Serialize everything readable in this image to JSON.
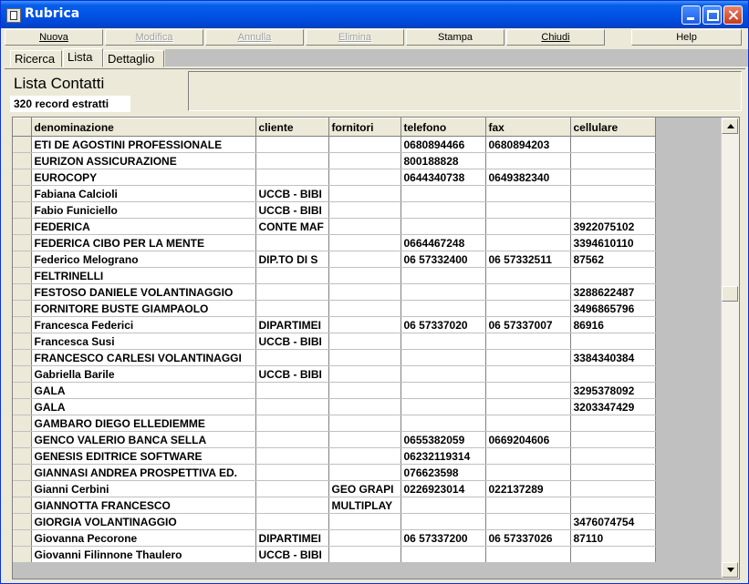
{
  "window": {
    "title": "Rubrica"
  },
  "toolbar": [
    {
      "label": "Nuova",
      "enabled": true
    },
    {
      "label": "Modifica",
      "enabled": false
    },
    {
      "label": "Annulla",
      "enabled": false
    },
    {
      "label": "Elimina",
      "enabled": false
    },
    {
      "label": "Stampa",
      "enabled": true
    },
    {
      "label": "Chiudi",
      "enabled": true
    },
    {
      "label": "Help",
      "enabled": true
    }
  ],
  "tabs": [
    {
      "label": "Ricerca",
      "active": false
    },
    {
      "label": "Lista",
      "active": true
    },
    {
      "label": "Dettaglio",
      "active": false
    }
  ],
  "list": {
    "title": "Lista Contatti",
    "record_count": "320 record estratti"
  },
  "table": {
    "columns": [
      "denominazione",
      "cliente",
      "fornitori",
      "telefono",
      "fax",
      "cellulare"
    ],
    "rows": [
      [
        "ETI DE AGOSTINI PROFESSIONALE",
        "",
        "",
        "0680894466",
        "0680894203",
        ""
      ],
      [
        "EURIZON ASSICURAZIONE",
        "",
        "",
        "800188828",
        "",
        ""
      ],
      [
        "EUROCOPY",
        "",
        "",
        "0644340738",
        "0649382340",
        ""
      ],
      [
        "Fabiana Calcioli",
        "UCCB - BIBI",
        "",
        "",
        "",
        ""
      ],
      [
        "Fabio Funiciello",
        "UCCB - BIBI",
        "",
        "",
        "",
        ""
      ],
      [
        "FEDERICA",
        "CONTE MAF",
        "",
        "",
        "",
        "3922075102"
      ],
      [
        "FEDERICA CIBO PER LA MENTE",
        "",
        "",
        "0664467248",
        "",
        "3394610110"
      ],
      [
        "Federico Melograno",
        "DIP.TO DI S",
        "",
        "06 57332400",
        "06 57332511",
        "87562"
      ],
      [
        "FELTRINELLI",
        "",
        "",
        "",
        "",
        ""
      ],
      [
        "FESTOSO DANIELE VOLANTINAGGIO",
        "",
        "",
        "",
        "",
        "3288622487"
      ],
      [
        "FORNITORE BUSTE GIAMPAOLO",
        "",
        "",
        "",
        "",
        "3496865796"
      ],
      [
        "Francesca Federici",
        "DIPARTIMEI",
        "",
        "06 57337020",
        "06 57337007",
        "86916"
      ],
      [
        "Francesca Susi",
        "UCCB - BIBI",
        "",
        "",
        "",
        ""
      ],
      [
        "FRANCESCO CARLESI VOLANTINAGGI",
        "",
        "",
        "",
        "",
        "3384340384"
      ],
      [
        "Gabriella Barile",
        "UCCB - BIBI",
        "",
        "",
        "",
        ""
      ],
      [
        "GALA",
        "",
        "",
        "",
        "",
        "3295378092"
      ],
      [
        "GALA",
        "",
        "",
        "",
        "",
        "3203347429"
      ],
      [
        "GAMBARO DIEGO ELLEDIEMME",
        "",
        "",
        "",
        "",
        ""
      ],
      [
        "GENCO VALERIO BANCA SELLA",
        "",
        "",
        "0655382059",
        "0669204606",
        ""
      ],
      [
        "GENESIS EDITRICE SOFTWARE",
        "",
        "",
        "06232119314",
        "",
        ""
      ],
      [
        "GIANNASI ANDREA PROSPETTIVA ED.",
        "",
        "",
        "076623598",
        "",
        ""
      ],
      [
        "Gianni Cerbini",
        "",
        "GEO GRAPI",
        "0226923014",
        "022137289",
        ""
      ],
      [
        "GIANNOTTA FRANCESCO",
        "",
        "MULTIPLAY",
        "",
        "",
        ""
      ],
      [
        "GIORGIA VOLANTINAGGIO",
        "",
        "",
        "",
        "",
        "3476074754"
      ],
      [
        "Giovanna Pecorone",
        "DIPARTIMEI",
        "",
        "06 57337200",
        "06 57337026",
        "87110"
      ],
      [
        "Giovanni Filinnone Thaulero",
        "UCCB - BIBI",
        "",
        "",
        "",
        ""
      ]
    ]
  }
}
